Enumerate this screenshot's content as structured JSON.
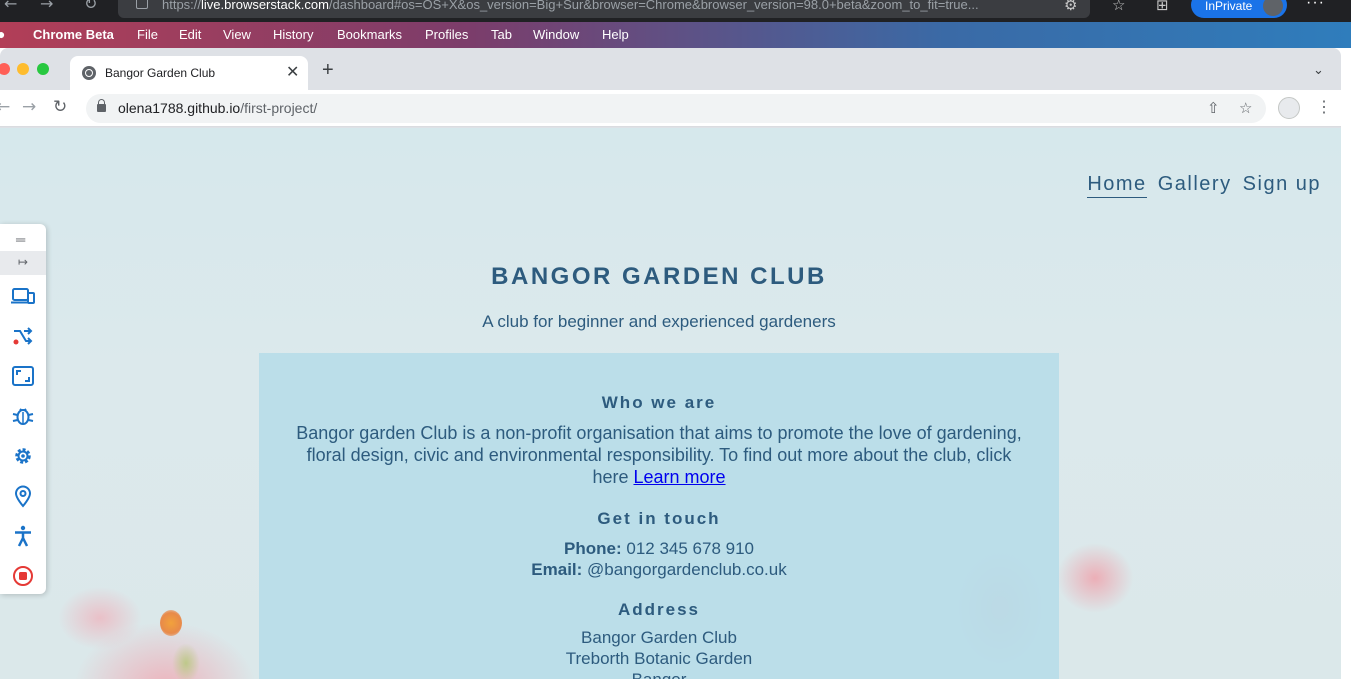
{
  "outer_browser": {
    "url_prefix": "https://",
    "url_host": "live.browserstack.com",
    "url_rest": "/dashboard#os=OS+X&os_version=Big+Sur&browser=Chrome&browser_version=98.0+beta&zoom_to_fit=true...",
    "inprivate_label": "InPrivate"
  },
  "menubar": {
    "app_name": "Chrome Beta",
    "items": [
      "File",
      "Edit",
      "View",
      "History",
      "Bookmarks",
      "Profiles",
      "Tab",
      "Window",
      "Help"
    ]
  },
  "chrome": {
    "tab_title": "Bangor Garden Club",
    "url_host": "olena1788.github.io",
    "url_path": "/first-project/"
  },
  "site": {
    "nav": [
      "Home",
      "Gallery",
      "Sign up"
    ],
    "active_nav": "Home",
    "title": "BANGOR GARDEN CLUB",
    "tagline": "A club for beginner and experienced gardeners",
    "who_heading": "Who we are",
    "who_text": "Bangor garden Club is a non-profit organisation that aims to promote the love of gardening, floral design, civic and environmental responsibility. To find out more about the club, click here",
    "learn_more": "Learn more",
    "touch_heading": "Get in touch",
    "phone_label": "Phone:",
    "phone": "012 345 678 910",
    "email_label": "Email:",
    "email": "@bangorgardenclub.co.uk",
    "address_heading": "Address",
    "address_lines": [
      "Bangor Garden Club",
      "Treborth Botanic Garden",
      "Bangor"
    ]
  },
  "side_toolbar": {
    "icons": [
      "device-switch-icon",
      "shuffle-icon",
      "resolution-icon",
      "bug-icon",
      "settings-icon",
      "location-icon",
      "accessibility-icon",
      "stop-session-icon"
    ]
  },
  "colors": {
    "site_text": "#2d5b7e",
    "card_bg": "#b6dce8",
    "link": "#0000ee",
    "bs_blue": "#1a73c8",
    "bs_red": "#e53935",
    "chrome_frame": "#dee1e6"
  }
}
